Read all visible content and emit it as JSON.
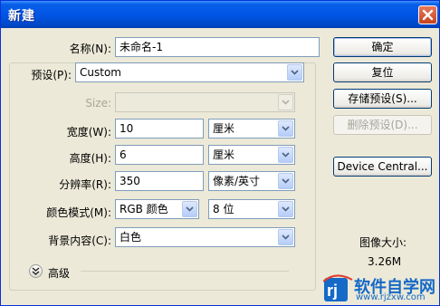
{
  "window": {
    "title": "新建",
    "close_glyph": "✕"
  },
  "form": {
    "name_label": "名称(N):",
    "name_value": "未命名-1",
    "preset_label": "预设(P):",
    "preset_value": "Custom",
    "size_label": "Size:",
    "size_value": "",
    "width_label": "宽度(W):",
    "width_value": "10",
    "width_unit": "厘米",
    "height_label": "高度(H):",
    "height_value": "6",
    "height_unit": "厘米",
    "resolution_label": "分辨率(R):",
    "resolution_value": "350",
    "resolution_unit": "像素/英寸",
    "color_mode_label": "颜色模式(M):",
    "color_mode_value": "RGB 颜色",
    "bit_depth_value": "8 位",
    "background_label": "背景内容(C):",
    "background_value": "白色",
    "advanced_label": "高级"
  },
  "buttons": {
    "ok": "确定",
    "reset": "复位",
    "save_preset": "存储预设(S)...",
    "delete_preset": "删除预设(D)...",
    "device_central": "Device Central..."
  },
  "image_size": {
    "label": "图像大小:",
    "value": "3.26M"
  },
  "watermark": {
    "logo_text": "软件自学网",
    "url": "www.rjzxw.com"
  },
  "colors": {
    "titlebar": "#0055e5",
    "dialog_bg": "#ece9d8",
    "field_border": "#7f9db9",
    "logo_blue": "#1569c7"
  }
}
